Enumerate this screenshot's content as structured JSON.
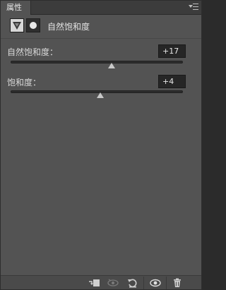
{
  "panel": {
    "tab_label": "属性",
    "menu_icon": "panel-menu-icon"
  },
  "header": {
    "title": "自然饱和度",
    "adjustment_icon": "vibrance-triangle-icon",
    "mask_icon": "layer-mask-icon"
  },
  "sliders": [
    {
      "label": "自然饱和度：",
      "value": "+17",
      "min": -100,
      "max": 100,
      "current": 17
    },
    {
      "label": "饱和度：",
      "value": "+4",
      "min": -100,
      "max": 100,
      "current": 4
    }
  ],
  "toolbar": {
    "buttons": [
      "clip-to-layer-icon",
      "view-previous-state-icon",
      "reset-icon",
      "visibility-eye-icon",
      "trash-icon"
    ]
  }
}
